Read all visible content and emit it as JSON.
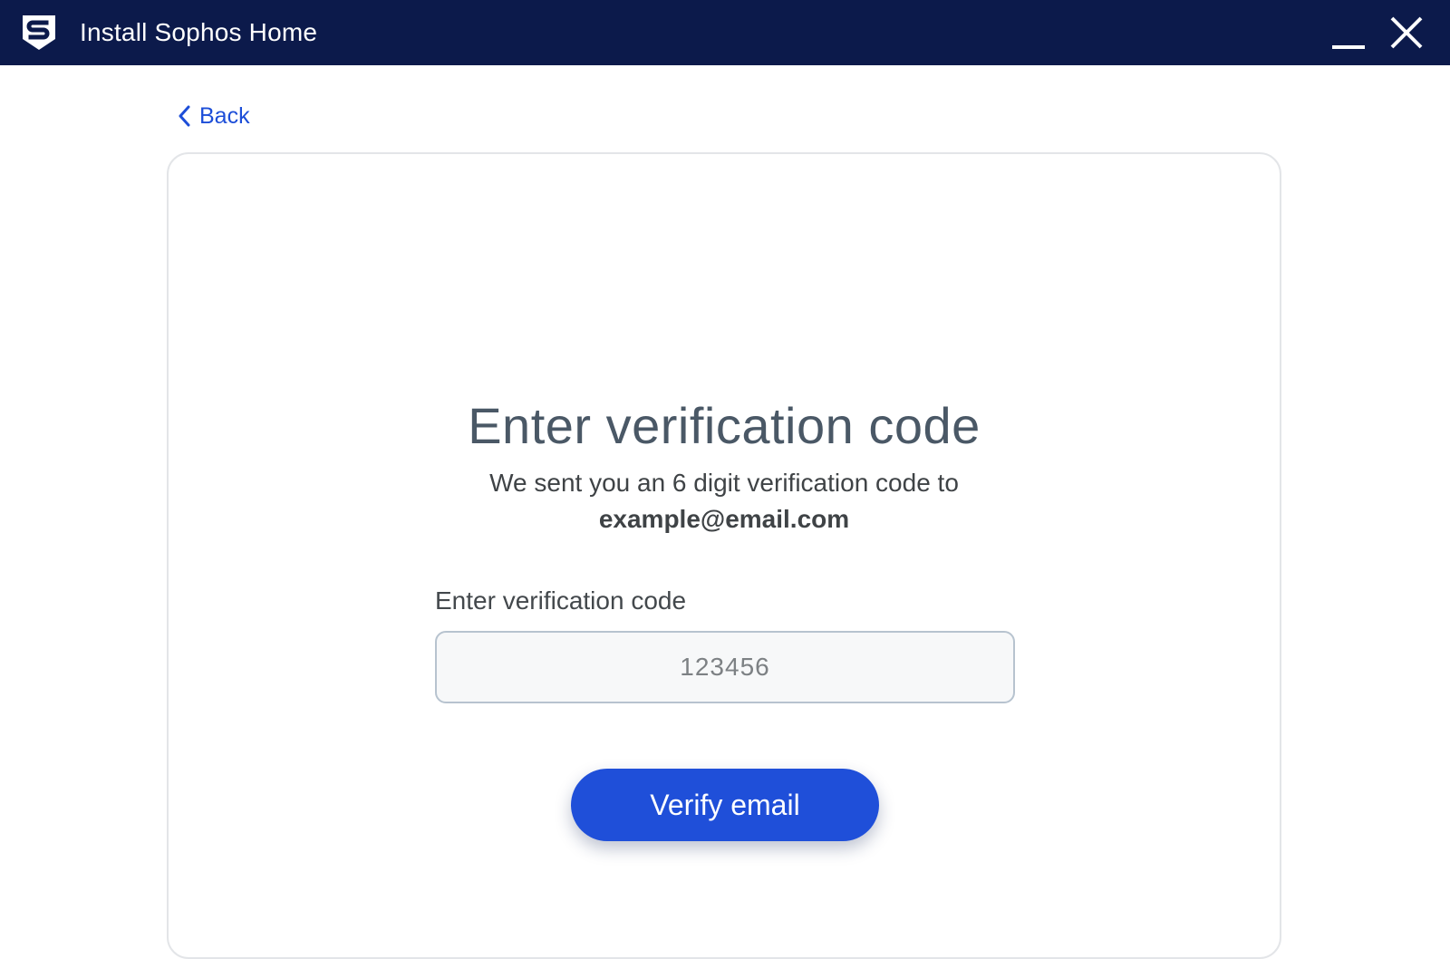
{
  "window": {
    "title": "Install Sophos Home",
    "logo_icon": "sophos-shield-logo",
    "minimize_icon": "minimize-icon",
    "close_icon": "close-icon",
    "titlebar_color": "#0c1a4b"
  },
  "nav": {
    "back_label": "Back",
    "back_icon": "chevron-left-icon"
  },
  "verification": {
    "heading": "Enter verification code",
    "message": "We sent you an 6 digit verification code to",
    "email": "example@email.com",
    "field_label": "Enter verification code",
    "code_value": "",
    "code_placeholder": "123456",
    "submit_label": "Verify email"
  },
  "colors": {
    "accent": "#1f4fd9",
    "link": "#1d4ed8",
    "heading": "#4a5866"
  }
}
